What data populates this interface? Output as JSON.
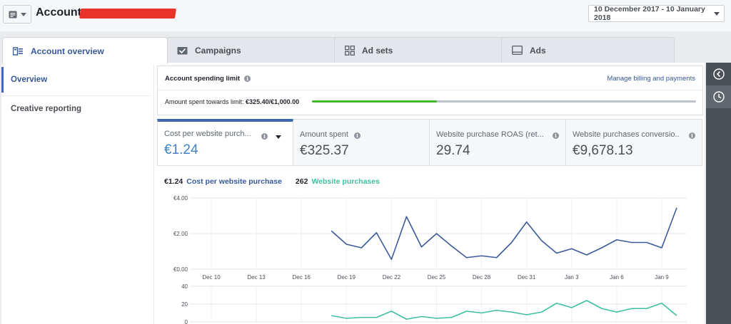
{
  "header": {
    "account_label": "Account:",
    "date_range": "10 December 2017 - 10 January 2018"
  },
  "tabs": [
    {
      "label": "Account overview",
      "icon": "account-overview-icon",
      "active": true
    },
    {
      "label": "Campaigns",
      "icon": "campaigns-icon",
      "active": false
    },
    {
      "label": "Ad sets",
      "icon": "ad-sets-icon",
      "active": false
    },
    {
      "label": "Ads",
      "icon": "ads-icon",
      "active": false
    }
  ],
  "sidebar": {
    "items": [
      {
        "label": "Overview",
        "active": true
      },
      {
        "label": "Creative reporting",
        "active": false
      }
    ]
  },
  "spending": {
    "title": "Account spending limit",
    "manage_link": "Manage billing and payments",
    "amount_prefix": "Amount spent towards limit: ",
    "amount_value": "€325.40/€1,000.00",
    "progress_fraction": 0.3254
  },
  "metrics": [
    {
      "label": "Cost per website purch...",
      "value": "€1.24"
    },
    {
      "label": "Amount spent",
      "value": "€325.37"
    },
    {
      "label": "Website purchase ROAS (ret...",
      "value": "29.74"
    },
    {
      "label": "Website purchases conversio...",
      "value": "€9,678.13"
    }
  ],
  "legend": {
    "value1": "€1.24",
    "label1": "Cost per website purchase",
    "value2": "262",
    "label2": "Website purchases"
  },
  "colors": {
    "series1": "#3b5a9a",
    "series2": "#3fbfa0",
    "accent": "#4267b2",
    "progress": "#42b72a"
  },
  "chart_data": [
    {
      "type": "line",
      "title": "",
      "ylim": [
        0,
        4
      ],
      "yticks": [
        "€0.00",
        "€2.00",
        "€4.00"
      ],
      "ytick_values": [
        0,
        2,
        4
      ],
      "xticks": [
        "Dec 10",
        "Dec 13",
        "Dec 16",
        "Dec 19",
        "Dec 22",
        "Dec 25",
        "Dec 28",
        "Dec 31",
        "Jan 3",
        "Jan 6",
        "Jan 9"
      ],
      "x": [
        "Dec 10",
        "Dec 11",
        "Dec 12",
        "Dec 13",
        "Dec 14",
        "Dec 15",
        "Dec 16",
        "Dec 17",
        "Dec 18",
        "Dec 19",
        "Dec 20",
        "Dec 21",
        "Dec 22",
        "Dec 23",
        "Dec 24",
        "Dec 25",
        "Dec 26",
        "Dec 27",
        "Dec 28",
        "Dec 29",
        "Dec 30",
        "Dec 31",
        "Jan 1",
        "Jan 2",
        "Jan 3",
        "Jan 4",
        "Jan 5",
        "Jan 6",
        "Jan 7",
        "Jan 8",
        "Jan 9",
        "Jan 10"
      ],
      "series": [
        {
          "name": "Cost per website purchase",
          "values": [
            null,
            null,
            null,
            null,
            null,
            null,
            null,
            null,
            2.15,
            1.4,
            1.2,
            2.05,
            0.55,
            2.95,
            1.25,
            2.0,
            1.3,
            0.65,
            0.75,
            0.65,
            1.5,
            2.65,
            1.6,
            0.9,
            1.15,
            0.8,
            1.2,
            1.65,
            1.5,
            1.5,
            1.2,
            3.45
          ]
        }
      ]
    },
    {
      "type": "line",
      "title": "",
      "ylim": [
        0,
        40
      ],
      "yticks": [
        "0",
        "20",
        "40"
      ],
      "ytick_values": [
        0,
        20,
        40
      ],
      "xticks": [],
      "series": [
        {
          "name": "Website purchases",
          "values": [
            null,
            null,
            null,
            null,
            null,
            null,
            null,
            null,
            7,
            4,
            5,
            5,
            12,
            3,
            6,
            4,
            5,
            12,
            10,
            13,
            11,
            8,
            11,
            21,
            16,
            24,
            15,
            11,
            15,
            15,
            21,
            7
          ]
        }
      ]
    }
  ]
}
